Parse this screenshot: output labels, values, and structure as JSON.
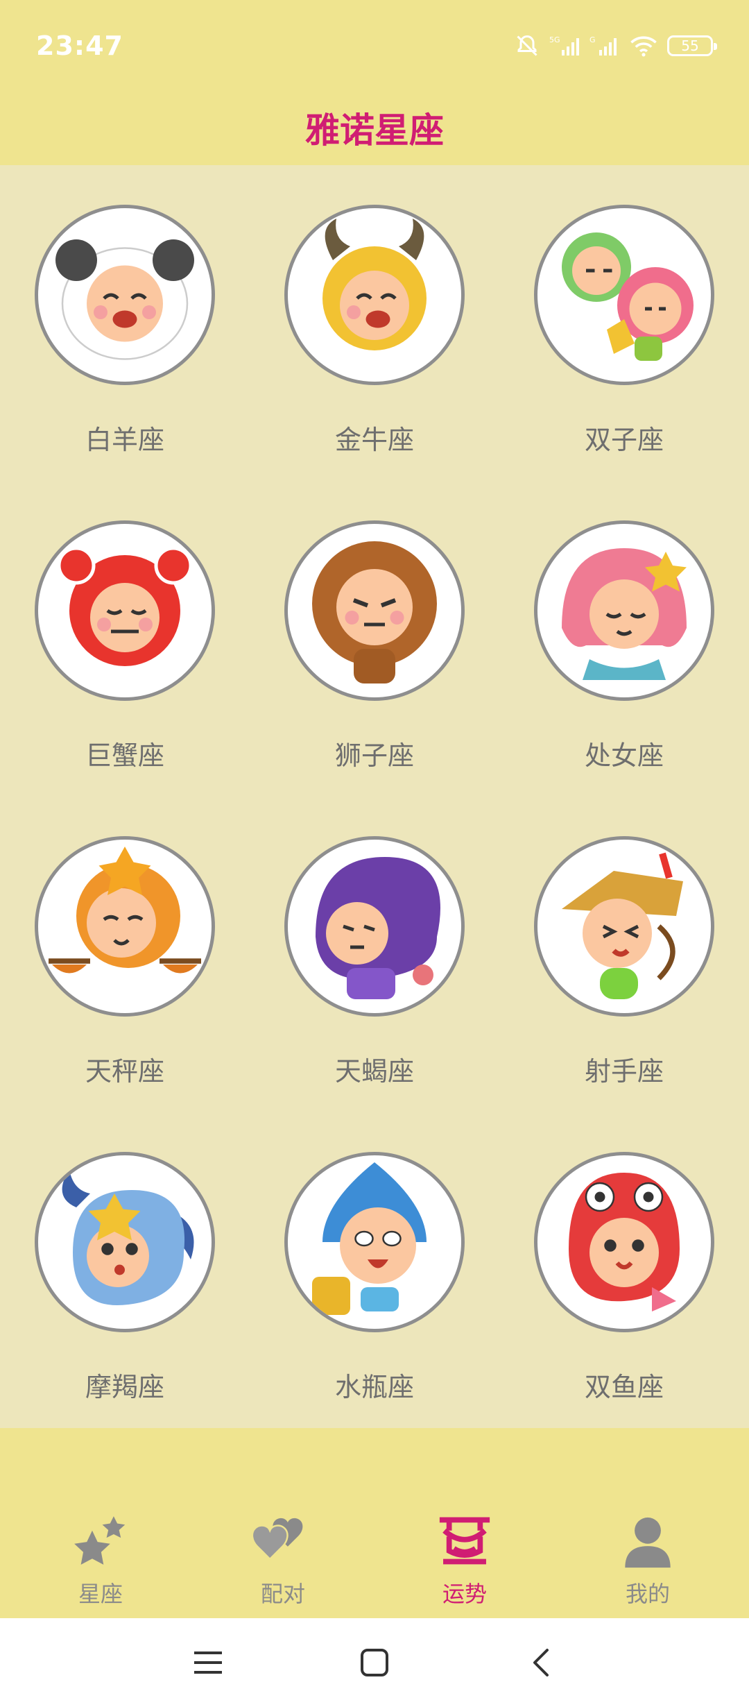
{
  "status_bar": {
    "time": "23:47",
    "icons": [
      "mute-bell-icon",
      "signal-5g-icon",
      "signal-g-icon",
      "wifi-icon",
      "battery-icon"
    ],
    "battery_level": "55"
  },
  "header": {
    "title": "雅诺星座"
  },
  "signs": [
    {
      "name": "白羊座",
      "icon": "aries-character-icon",
      "color": "#F08080"
    },
    {
      "name": "金牛座",
      "icon": "taurus-character-icon",
      "color": "#E9B52A"
    },
    {
      "name": "双子座",
      "icon": "gemini-character-icon",
      "color": "#9BD25A"
    },
    {
      "name": "巨蟹座",
      "icon": "cancer-character-icon",
      "color": "#E8342D"
    },
    {
      "name": "狮子座",
      "icon": "leo-character-icon",
      "color": "#B0652A"
    },
    {
      "name": "处女座",
      "icon": "virgo-character-icon",
      "color": "#EF7B93"
    },
    {
      "name": "天秤座",
      "icon": "libra-character-icon",
      "color": "#F0952A"
    },
    {
      "name": "天蝎座",
      "icon": "scorpio-character-icon",
      "color": "#6B3FA8"
    },
    {
      "name": "射手座",
      "icon": "sagittarius-character-icon",
      "color": "#D9A23A"
    },
    {
      "name": "摩羯座",
      "icon": "capricorn-character-icon",
      "color": "#7FB0E3"
    },
    {
      "name": "水瓶座",
      "icon": "aquarius-character-icon",
      "color": "#3D8DD6"
    },
    {
      "name": "双鱼座",
      "icon": "pisces-character-icon",
      "color": "#E53B3B"
    }
  ],
  "bottom_nav": [
    {
      "label": "星座",
      "icon": "stars-icon",
      "active": false
    },
    {
      "label": "配对",
      "icon": "hearts-icon",
      "active": false
    },
    {
      "label": "运势",
      "icon": "fortune-icon",
      "active": true
    },
    {
      "label": "我的",
      "icon": "user-icon",
      "active": false
    }
  ],
  "system_nav": {
    "icons": [
      "menu-icon",
      "home-icon",
      "back-icon"
    ]
  },
  "colors": {
    "accent": "#D01D73",
    "header_bg": "#EFE48F",
    "content_bg": "#EDE6BB",
    "label_gray": "#6E6E6E",
    "inactive_gray": "#8A8A8A",
    "circle_border": "#8E8E8E"
  }
}
